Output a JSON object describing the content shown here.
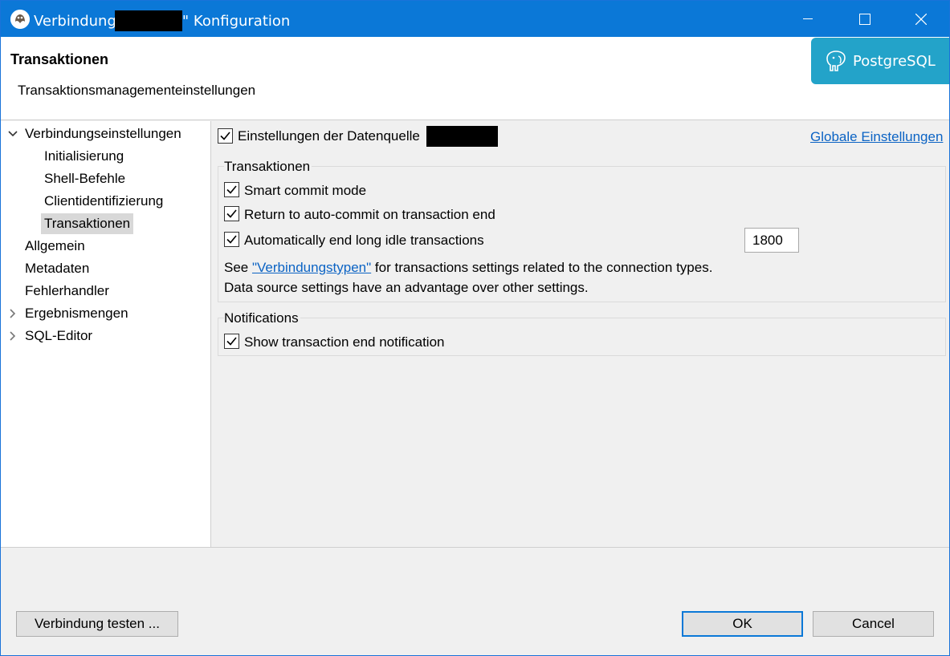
{
  "window": {
    "title_prefix": "Verbindung",
    "title_suffix": "\" Konfiguration"
  },
  "header": {
    "title": "Transaktionen",
    "description": "Transaktionsmanagementeinstellungen",
    "badge_text": "PostgreSQL"
  },
  "tree": {
    "items": [
      {
        "label": "Verbindungseinstellungen",
        "expanded": true
      },
      {
        "label": "Initialisierung"
      },
      {
        "label": "Shell-Befehle"
      },
      {
        "label": "Clientidentifizierung"
      },
      {
        "label": "Transaktionen",
        "selected": true
      },
      {
        "label": "Allgemein"
      },
      {
        "label": "Metadaten"
      },
      {
        "label": "Fehlerhandler"
      },
      {
        "label": "Ergebnismengen",
        "expanded": false
      },
      {
        "label": "SQL-Editor",
        "expanded": false
      }
    ]
  },
  "content": {
    "datasource_checkbox_label": "Einstellungen der Datenquelle",
    "datasource_checked": true,
    "global_link": "Globale Einstellungen",
    "transactions_group": {
      "title": "Transaktionen",
      "smart_commit": "Smart commit mode",
      "auto_commit": "Return to auto-commit on transaction end",
      "auto_end": "Automatically end long idle transactions",
      "idle_timeout": "1800",
      "info_see": "See",
      "info_link": "\"Verbindungstypen\"",
      "info_rest": "for transactions settings related to the connection types.",
      "info_line2": "Data source settings have an advantage over other settings."
    },
    "notifications_group": {
      "title": "Notifications",
      "show_end": "Show transaction end notification"
    }
  },
  "footer": {
    "test_button": "Verbindung testen ...",
    "ok_button": "OK",
    "cancel_button": "Cancel"
  },
  "colors": {
    "titlebar": "#0b78d7",
    "badge": "#23a3c9",
    "link": "#0b63c4"
  }
}
